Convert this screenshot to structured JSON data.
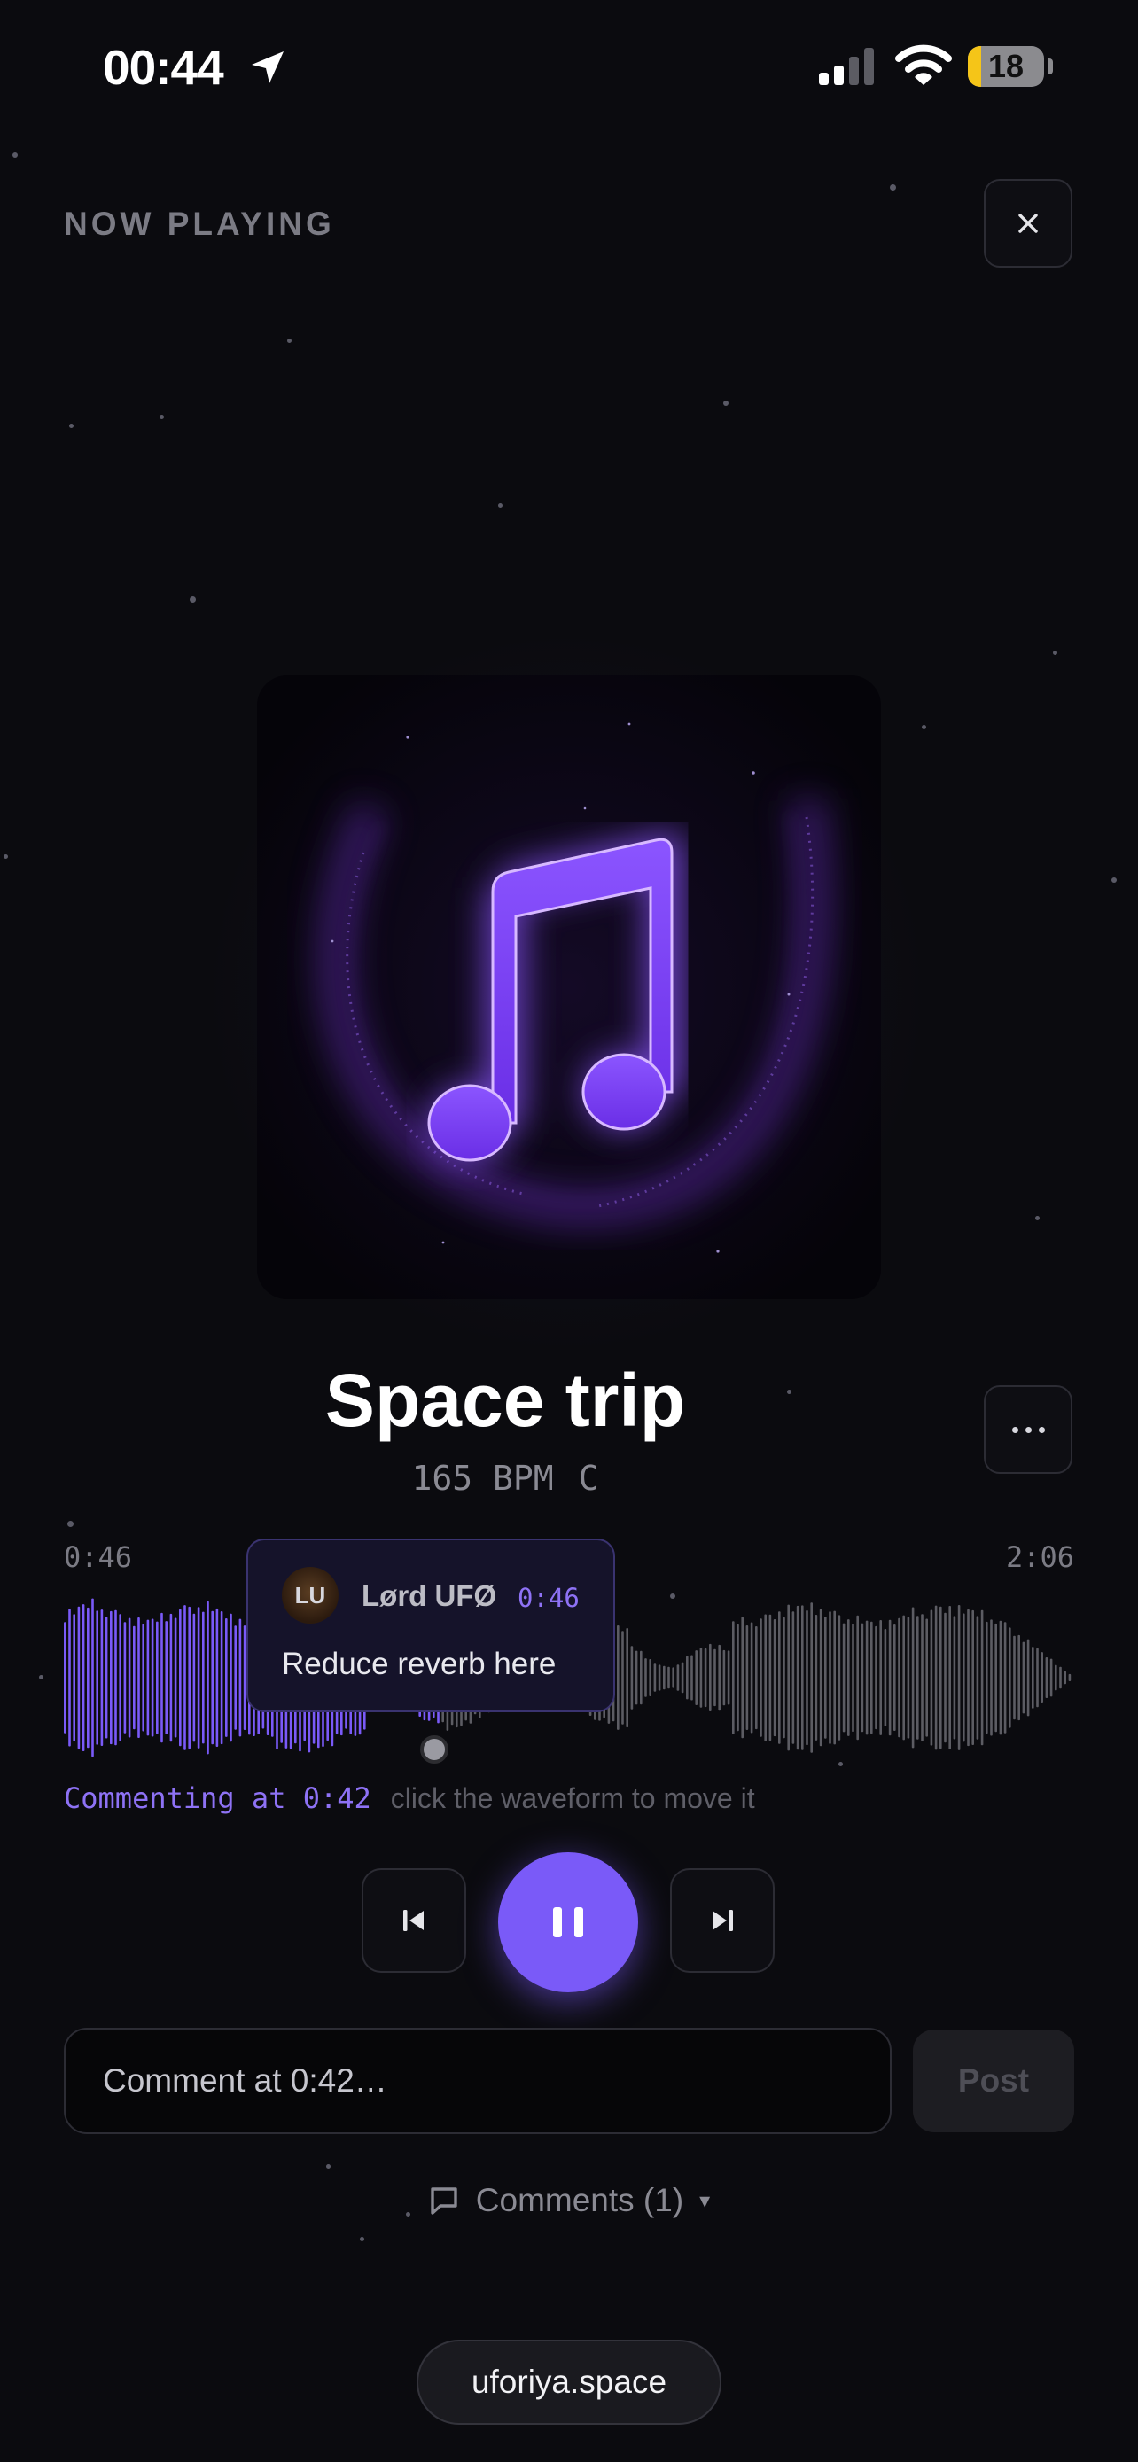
{
  "status_bar": {
    "time": "00:44",
    "battery": "18",
    "battery_level": 0.18,
    "icons": [
      "location-arrow-icon",
      "cellular-signal-icon",
      "wifi-icon",
      "battery-icon"
    ]
  },
  "header": {
    "title": "NOW PLAYING",
    "close_icon": "close-icon"
  },
  "track": {
    "title": "Space trip",
    "bpm": "165 BPM",
    "key": "C",
    "art_icon": "music-note-icon",
    "more_icon": "more-horizontal-icon"
  },
  "waveform": {
    "elapsed": "0:46",
    "total": "2:06",
    "progress": 0.37,
    "played_color": "#7a5af8",
    "unplayed_color": "#5c5c63"
  },
  "comment_tooltip": {
    "avatar_initials": "LU",
    "author": "Lørd UFØ",
    "timestamp": "0:46",
    "text": "Reduce reverb here"
  },
  "comment_hint": {
    "position": "Commenting at 0:42",
    "help": "click the waveform to move it"
  },
  "controls": {
    "previous_icon": "skip-previous-icon",
    "pause_icon": "pause-icon",
    "next_icon": "skip-next-icon"
  },
  "comment_form": {
    "placeholder": "Comment at 0:42…",
    "post_label": "Post"
  },
  "comments_toggle": {
    "label": "Comments (1)",
    "icon": "comment-icon",
    "caret": "▾"
  },
  "footer": {
    "domain": "uforiya.space"
  },
  "colors": {
    "accent": "#7a5af8",
    "background": "#0b0b0f"
  }
}
